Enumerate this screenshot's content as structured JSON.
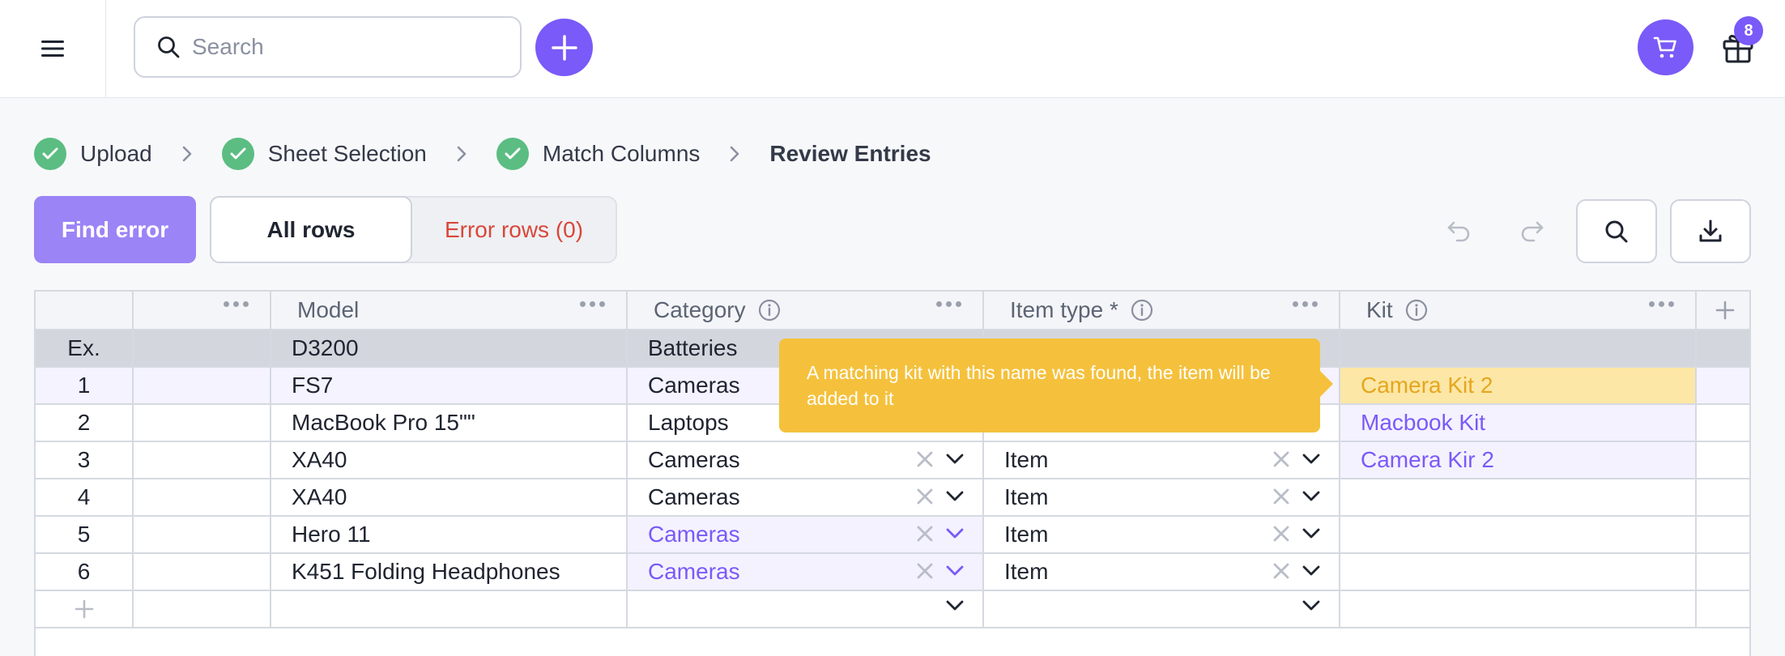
{
  "header": {
    "search_placeholder": "Search",
    "gift_badge": "8"
  },
  "steps": [
    {
      "label": "Upload",
      "state": "done"
    },
    {
      "label": "Sheet Selection",
      "state": "done"
    },
    {
      "label": "Match Columns",
      "state": "done"
    },
    {
      "label": "Review Entries",
      "state": "current"
    }
  ],
  "actions": {
    "find_error": "Find error",
    "all_rows": "All rows",
    "error_rows": "Error rows (0)"
  },
  "table": {
    "columns": [
      "",
      "Model",
      "Category",
      "Item type *",
      "Kit"
    ],
    "example": {
      "index": "Ex.",
      "model": "D3200",
      "category": "Batteries",
      "item_type": "",
      "kit": ""
    },
    "rows": [
      {
        "index": "1",
        "model": "FS7",
        "category": "Cameras",
        "item_type": "",
        "kit": "Camera Kit 2"
      },
      {
        "index": "2",
        "model": "MacBook Pro 15\"\"",
        "category": "Laptops",
        "item_type": "",
        "kit": "Macbook Kit"
      },
      {
        "index": "3",
        "model": "XA40",
        "category": "Cameras",
        "item_type": "Item",
        "kit": "Camera Kir 2"
      },
      {
        "index": "4",
        "model": "XA40",
        "category": "Cameras",
        "item_type": "Item",
        "kit": ""
      },
      {
        "index": "5",
        "model": "Hero 11",
        "category": "Cameras",
        "item_type": "Item",
        "kit": ""
      },
      {
        "index": "6",
        "model": "K451 Folding Headphones",
        "category": "Cameras",
        "item_type": "Item",
        "kit": ""
      }
    ]
  },
  "tooltip": {
    "text": "A matching kit with this name was found, the item will be added to it"
  },
  "colors": {
    "accent": "#7a5af8",
    "success": "#5bbd82",
    "error": "#d9473a",
    "tooltip": "#f5c13c"
  }
}
